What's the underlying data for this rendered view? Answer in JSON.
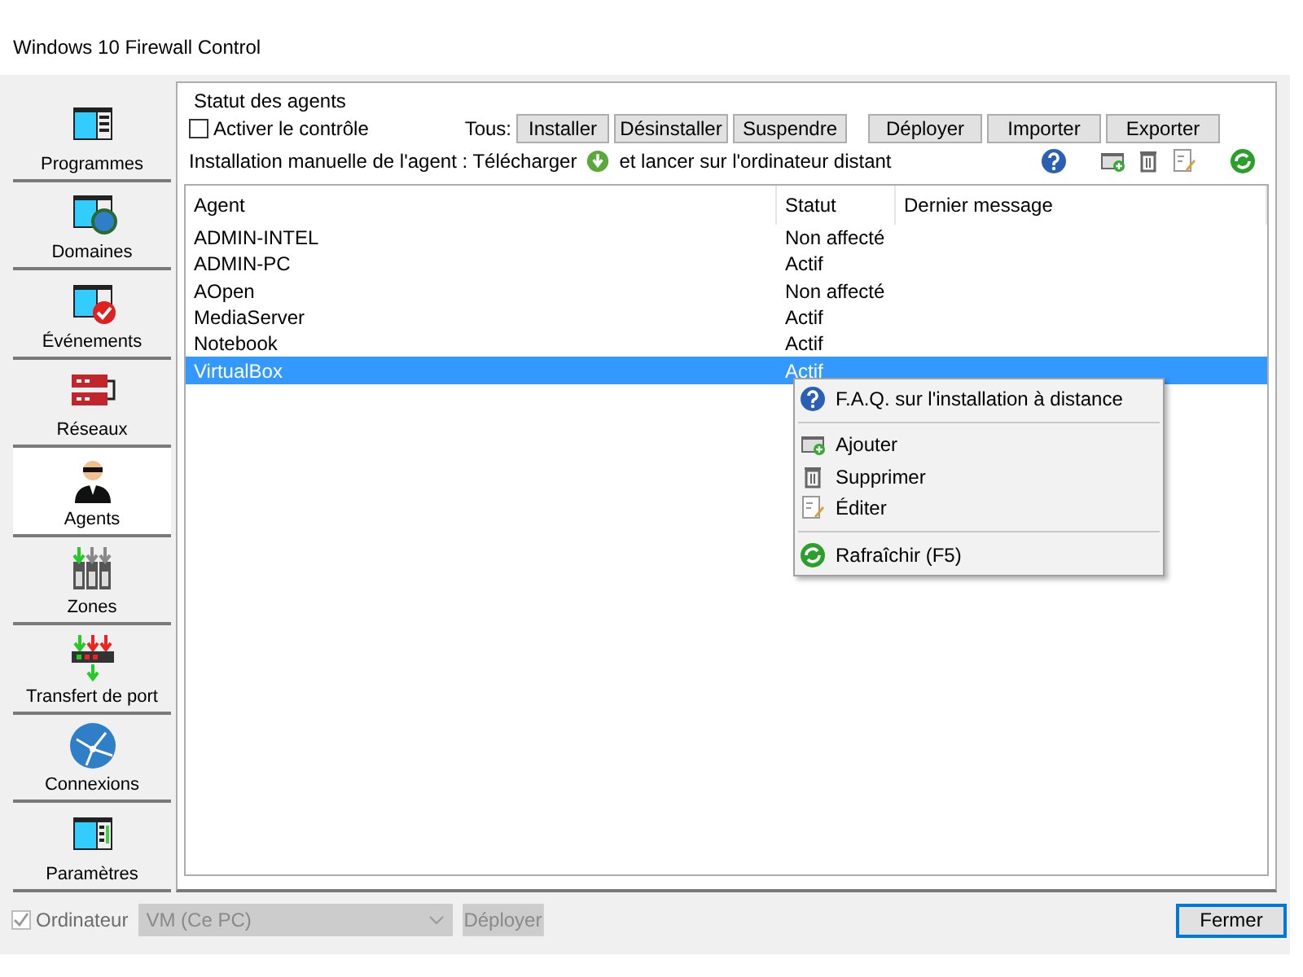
{
  "window": {
    "title": "Windows 10 Firewall Control"
  },
  "sidebar": {
    "items": [
      {
        "label": "Programmes",
        "selected": false
      },
      {
        "label": "Domaines",
        "selected": false
      },
      {
        "label": "Événements",
        "selected": false
      },
      {
        "label": "Réseaux",
        "selected": false
      },
      {
        "label": "Agents",
        "selected": true
      },
      {
        "label": "Zones",
        "selected": false
      },
      {
        "label": "Transfert de port",
        "selected": false
      },
      {
        "label": "Connexions",
        "selected": false
      },
      {
        "label": "Paramètres",
        "selected": false
      }
    ]
  },
  "group": {
    "title": "Statut des agents",
    "enable_checkbox": {
      "label": "Activer le contrôle",
      "checked": false
    },
    "all_label": "Tous:",
    "buttons": [
      "Installer",
      "Désinstaller",
      "Suspendre"
    ],
    "buttons_right": [
      "Déployer",
      "Importer",
      "Exporter"
    ],
    "manual_text": "Installation manuelle de l'agent : Télécharger",
    "manual_text_after": "et lancer sur l'ordinateur distant"
  },
  "table": {
    "columns": [
      "Agent",
      "Statut",
      "Dernier message"
    ],
    "rows": [
      {
        "agent": "ADMIN-INTEL",
        "status": "Non affecté",
        "selected": false
      },
      {
        "agent": "ADMIN-PC",
        "status": "Actif",
        "selected": false
      },
      {
        "agent": "AOpen",
        "status": "Non affecté",
        "selected": false
      },
      {
        "agent": "MediaServer",
        "status": "Actif",
        "selected": false
      },
      {
        "agent": "Notebook",
        "status": "Actif",
        "selected": false
      },
      {
        "agent": "VirtualBox",
        "status": "Actif",
        "selected": true
      }
    ]
  },
  "context_menu": {
    "groups": [
      [
        "F.A.Q. sur l'installation à distance"
      ],
      [
        "Ajouter",
        "Supprimer",
        "Éditer"
      ],
      [
        "Rafraîchir (F5)"
      ]
    ]
  },
  "footer": {
    "computer_checkbox": {
      "label": "Ordinateur",
      "checked": true,
      "disabled": true
    },
    "computer_select": {
      "value": "VM (Ce PC)",
      "disabled": true
    },
    "deploy_button": {
      "label": "Déployer",
      "disabled": true
    },
    "close_button": "Fermer"
  }
}
